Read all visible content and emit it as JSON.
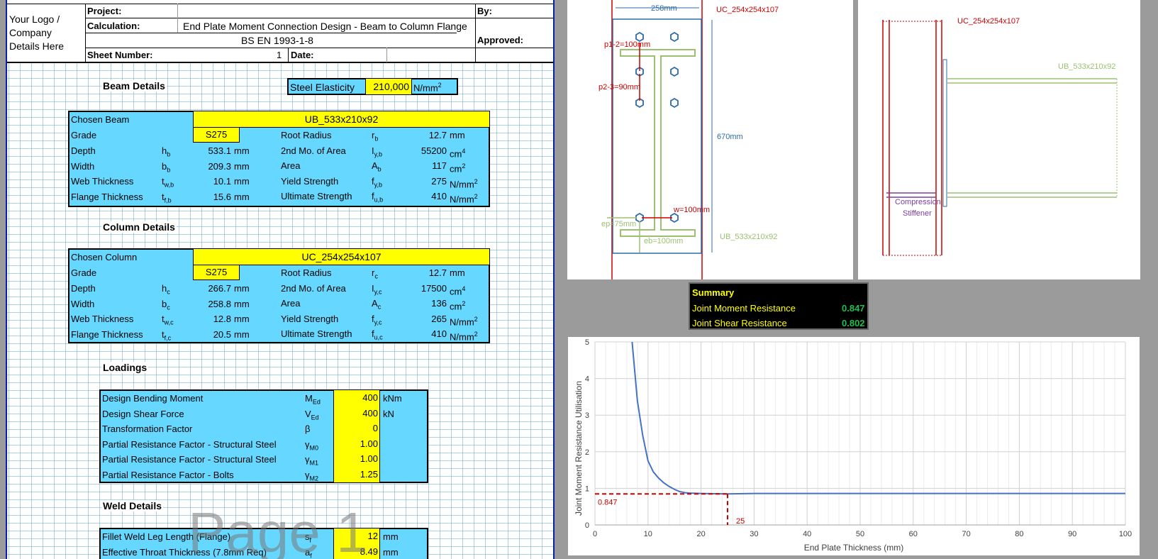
{
  "header": {
    "logo": "Your Logo / Company Details Here",
    "project_label": "Project:",
    "calculation_label": "Calculation:",
    "calculation_value": "End Plate Moment Connection Design - Beam to Column Flange",
    "standard": "BS EN 1993-1-8",
    "sheet_number_label": "Sheet Number:",
    "sheet_number_value": "1",
    "date_label": "Date:",
    "by_label": "By:",
    "approved_label": "Approved:"
  },
  "beam": {
    "section_title": "Beam Details",
    "elasticity_label": "Steel Elasticity",
    "elasticity_value": "210,000",
    "elasticity_unit": "N/mm",
    "chosen_label": "Chosen Beam",
    "chosen_value": "UB_533x210x92",
    "grade_label": "Grade",
    "grade_value": "S275",
    "left_rows": [
      {
        "label": "Depth",
        "sym": "h",
        "sub": "b",
        "value": "533.1",
        "unit": "mm"
      },
      {
        "label": "Width",
        "sym": "b",
        "sub": "b",
        "value": "209.3",
        "unit": "mm"
      },
      {
        "label": "Web Thickness",
        "sym": "t",
        "sub": "w,b",
        "value": "10.1",
        "unit": "mm"
      },
      {
        "label": "Flange Thickness",
        "sym": "t",
        "sub": "f,b",
        "value": "15.6",
        "unit": "mm"
      }
    ],
    "right_rows": [
      {
        "label": "Root Radius",
        "sym": "r",
        "sub": "b",
        "value": "12.7",
        "unit": "mm",
        "sup": ""
      },
      {
        "label": "2nd Mo. of Area",
        "sym": "I",
        "sub": "y,b",
        "value": "55200",
        "unit": "cm",
        "sup": "4"
      },
      {
        "label": "Area",
        "sym": "A",
        "sub": "b",
        "value": "117",
        "unit": "cm",
        "sup": "2"
      },
      {
        "label": "Yield Strength",
        "sym": "f",
        "sub": "y,b",
        "value": "275",
        "unit": "N/mm",
        "sup": "2"
      },
      {
        "label": "Ultimate Strength",
        "sym": "f",
        "sub": "u,b",
        "value": "410",
        "unit": "N/mm",
        "sup": "2"
      }
    ]
  },
  "column": {
    "section_title": "Column Details",
    "chosen_label": "Chosen Column",
    "chosen_value": "UC_254x254x107",
    "grade_label": "Grade",
    "grade_value": "S275",
    "left_rows": [
      {
        "label": "Depth",
        "sym": "h",
        "sub": "c",
        "value": "266.7",
        "unit": "mm"
      },
      {
        "label": "Width",
        "sym": "b",
        "sub": "c",
        "value": "258.8",
        "unit": "mm"
      },
      {
        "label": "Web Thickness",
        "sym": "t",
        "sub": "w,c",
        "value": "12.8",
        "unit": "mm"
      },
      {
        "label": "Flange Thickness",
        "sym": "t",
        "sub": "f,c",
        "value": "20.5",
        "unit": "mm"
      }
    ],
    "right_rows": [
      {
        "label": "Root Radius",
        "sym": "r",
        "sub": "c",
        "value": "12.7",
        "unit": "mm",
        "sup": ""
      },
      {
        "label": "2nd Mo. of Area",
        "sym": "I",
        "sub": "y,c",
        "value": "17500",
        "unit": "cm",
        "sup": "4"
      },
      {
        "label": "Area",
        "sym": "A",
        "sub": "c",
        "value": "136",
        "unit": "cm",
        "sup": "2"
      },
      {
        "label": "Yield Strength",
        "sym": "f",
        "sub": "y,c",
        "value": "265",
        "unit": "N/mm",
        "sup": "2"
      },
      {
        "label": "Ultimate Strength",
        "sym": "f",
        "sub": "u,c",
        "value": "410",
        "unit": "N/mm",
        "sup": "2"
      }
    ]
  },
  "loadings": {
    "section_title": "Loadings",
    "rows": [
      {
        "label": "Design Bending Moment",
        "sym": "M",
        "sub": "Ed",
        "value": "400",
        "unit": "kNm"
      },
      {
        "label": "Design Shear Force",
        "sym": "V",
        "sub": "Ed",
        "value": "400",
        "unit": "kN"
      },
      {
        "label": "Transformation Factor",
        "sym": "β",
        "sub": "",
        "value": "0",
        "unit": ""
      },
      {
        "label": "Partial Resistance Factor - Structural Steel",
        "sym": "γ",
        "sub": "M0",
        "value": "1.00",
        "unit": ""
      },
      {
        "label": "Partial Resistance Factor - Structural Steel",
        "sym": "γ",
        "sub": "M1",
        "value": "1.00",
        "unit": ""
      },
      {
        "label": "Partial Resistance Factor - Bolts",
        "sym": "γ",
        "sub": "M2",
        "value": "1.25",
        "unit": ""
      }
    ]
  },
  "weld": {
    "section_title": "Weld Details",
    "rows": [
      {
        "label": "Fillet Weld Leg Length (Flange)",
        "sym": "s",
        "sub": "f",
        "value": "12",
        "unit": "mm"
      },
      {
        "label": "Effective Throat Thickness (7.8mm Req)",
        "sym": "a",
        "sub": "f",
        "value": "8.49",
        "unit": "mm"
      }
    ]
  },
  "watermark": "Page 1",
  "front_view": {
    "width_dim": "258mm",
    "column_label": "UC_254x254x107",
    "p1_label": "p1-2=100mm",
    "p2_label": "p2-3=90mm",
    "height_dim": "670mm",
    "w_label": "w=100mm",
    "ep_label": "ep=75mm",
    "eb_label": "eb=100mm",
    "beam_label": "UB_533x210x92"
  },
  "side_view": {
    "column_label": "UC_254x254x107",
    "beam_label": "UB_533x210x92",
    "stiffener_label_1": "Compression",
    "stiffener_label_2": "Stiffener"
  },
  "summary": {
    "title": "Summary",
    "moment_label": "Joint Moment Resistance",
    "moment_value": "0.847",
    "shear_label": "Joint Shear Resistance",
    "shear_value": "0.802"
  },
  "chart_data": {
    "type": "line",
    "xlabel": "End Plate Thickness (mm)",
    "ylabel": "Joint Moment Resistance Utilisation",
    "xlim": [
      0,
      100
    ],
    "ylim": [
      0,
      5
    ],
    "xticks": [
      0,
      10,
      20,
      30,
      40,
      50,
      60,
      70,
      80,
      90,
      100
    ],
    "yticks": [
      0,
      1,
      2,
      3,
      4,
      5
    ],
    "grid": true,
    "series": [
      {
        "x": [
          7,
          8,
          9,
          10,
          11,
          12,
          13,
          14,
          15,
          16,
          17,
          18,
          20,
          25,
          30,
          40,
          50,
          60,
          70,
          80,
          90,
          100
        ],
        "y": [
          5.0,
          3.4,
          2.45,
          1.75,
          1.45,
          1.28,
          1.15,
          1.05,
          0.97,
          0.91,
          0.88,
          0.87,
          0.86,
          0.847,
          0.86,
          0.86,
          0.86,
          0.86,
          0.86,
          0.86,
          0.86,
          0.86
        ]
      }
    ],
    "marker": {
      "x": 25,
      "y": 0.847,
      "x_label": "25",
      "y_label": "0.847"
    }
  }
}
